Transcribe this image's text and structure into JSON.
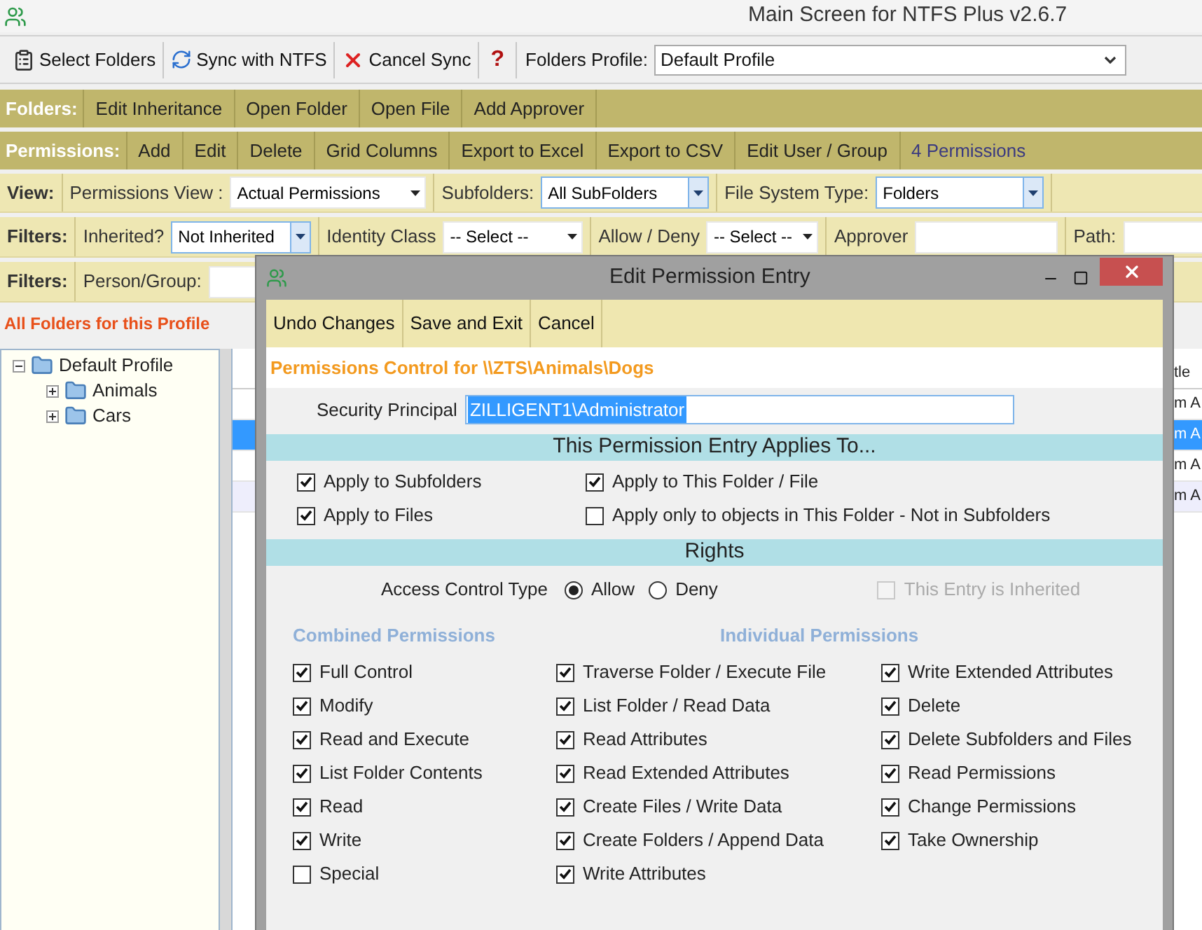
{
  "window": {
    "title": "Main Screen for NTFS Plus v2.6.7"
  },
  "toolbar": {
    "buttons": [
      {
        "label": "Select Folders",
        "kind": "select"
      },
      {
        "label": "Sync with NTFS",
        "kind": "sync"
      },
      {
        "label": "Cancel Sync",
        "kind": "cancel"
      },
      {
        "label": "?",
        "kind": "help"
      }
    ],
    "profile_label": "Folders Profile:",
    "profile_value": "Default Profile"
  },
  "folders_bar": {
    "label": "Folders:",
    "buttons": [
      "Edit Inheritance",
      "Open Folder",
      "Open File",
      "Add Approver"
    ]
  },
  "permissions_bar": {
    "label": "Permissions:",
    "buttons": [
      "Add",
      "Edit",
      "Delete",
      "Grid Columns",
      "Export to Excel",
      "Export to CSV",
      "Edit User / Group"
    ],
    "count": "4 Permissions"
  },
  "view_bar": {
    "label": "View:",
    "fields": [
      {
        "label": "Permissions View :",
        "kind": "dropdown",
        "value": "Actual Permissions",
        "focused": false
      },
      {
        "label": "Subfolders:",
        "kind": "dropdown",
        "value": "All SubFolders",
        "focused": true
      },
      {
        "label": "File System Type:",
        "kind": "dropdown",
        "value": "Folders",
        "focused": true
      }
    ]
  },
  "filters_bar": {
    "label": "Filters:",
    "fields": [
      {
        "label": "Inherited?",
        "kind": "dropdown",
        "value": "Not Inherited",
        "focused": true
      },
      {
        "label": "Identity Class",
        "kind": "dropdown",
        "value": "-- Select --",
        "focused": false
      },
      {
        "label": "Allow / Deny",
        "kind": "dropdown",
        "value": "-- Select --",
        "focused": false
      },
      {
        "label": "Approver",
        "kind": "text",
        "focused": false
      },
      {
        "label": "Path:",
        "kind": "text",
        "focused": false
      }
    ]
  },
  "filters_bar_2": {
    "label": "Filters:",
    "fields": [
      {
        "label": "Person/Group:",
        "kind": "text",
        "focused": false
      }
    ]
  },
  "section_title": "All Folders for this Profile",
  "tree": [
    {
      "label": "Default Profile",
      "expanded": true,
      "children": [
        {
          "label": "Animals",
          "expanded": false
        },
        {
          "label": "Cars",
          "expanded": false
        }
      ]
    }
  ],
  "grid": {
    "column_header": "tle",
    "rows": [
      {
        "text": "m A",
        "selected": false
      },
      {
        "text": "m A",
        "selected": true
      },
      {
        "text": "m A",
        "selected": false
      },
      {
        "text": "m A",
        "selected": false
      }
    ]
  },
  "dialog": {
    "title": "Edit Permission Entry",
    "buttons": [
      "Undo Changes",
      "Save and Exit",
      "Cancel"
    ],
    "heading": "Permissions Control for \\\\ZTS\\Animals\\Dogs",
    "principal_label": "Security Principal",
    "principal_value": "ZILLIGENT1\\Administrator",
    "applies_header": "This Permission Entry Applies To...",
    "applies": [
      {
        "label": "Apply to Subfolders",
        "checked": true
      },
      {
        "label": "Apply to This Folder / File",
        "checked": true
      },
      {
        "label": "Apply to Files",
        "checked": true
      },
      {
        "label": "Apply only to objects in This Folder - Not in Subfolders",
        "checked": false
      }
    ],
    "rights_header": "Rights",
    "access_label": "Access Control Type",
    "access_options": [
      {
        "label": "Allow",
        "selected": true
      },
      {
        "label": "Deny",
        "selected": false
      }
    ],
    "inherited": {
      "label": "This Entry is Inherited",
      "checked": false,
      "disabled": true
    },
    "combined": {
      "title": "Combined Permissions",
      "items": [
        {
          "label": "Full Control",
          "checked": true
        },
        {
          "label": "Modify",
          "checked": true
        },
        {
          "label": "Read and Execute",
          "checked": true
        },
        {
          "label": "List Folder Contents",
          "checked": true
        },
        {
          "label": "Read",
          "checked": true
        },
        {
          "label": "Write",
          "checked": true
        },
        {
          "label": "Special",
          "checked": false
        }
      ]
    },
    "individual": {
      "title": "Individual Permissions",
      "items": [
        {
          "label": "Traverse Folder / Execute File",
          "checked": true
        },
        {
          "label": "List Folder / Read Data",
          "checked": true
        },
        {
          "label": "Read Attributes",
          "checked": true
        },
        {
          "label": "Read Extended Attributes",
          "checked": true
        },
        {
          "label": "Create Files / Write Data",
          "checked": true
        },
        {
          "label": "Create Folders / Append Data",
          "checked": true
        },
        {
          "label": "Write Attributes",
          "checked": true
        },
        {
          "label": "Write Extended Attributes",
          "checked": true
        },
        {
          "label": "Delete",
          "checked": true
        },
        {
          "label": "Delete Subfolders and Files",
          "checked": true
        },
        {
          "label": "Read Permissions",
          "checked": true
        },
        {
          "label": "Change Permissions",
          "checked": true
        },
        {
          "label": "Take Ownership",
          "checked": true
        }
      ]
    }
  }
}
